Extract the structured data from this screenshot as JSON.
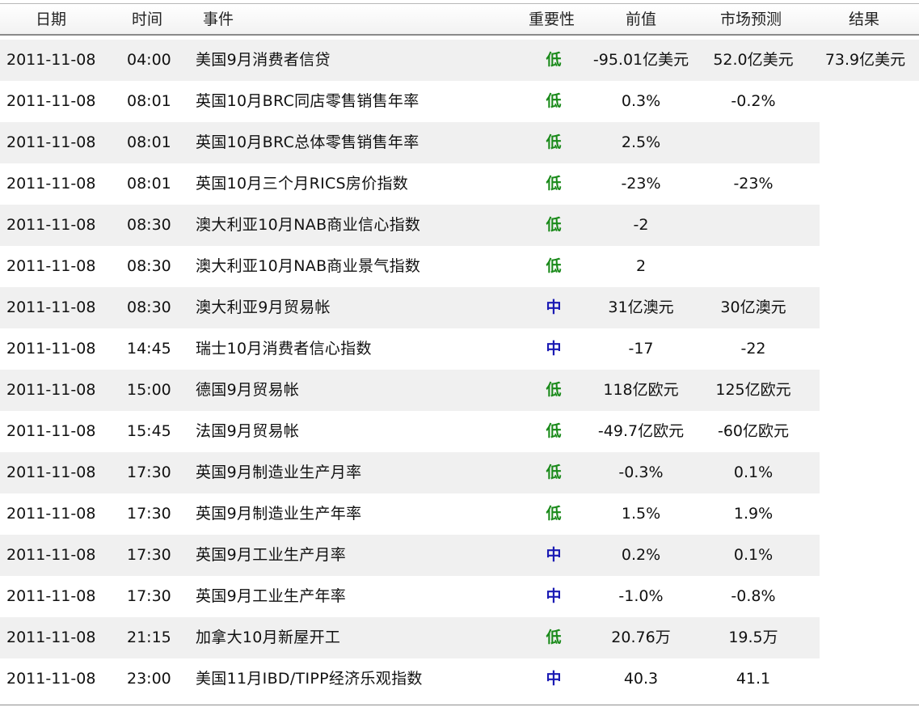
{
  "header": {
    "date": "日期",
    "time": "时间",
    "event": "事件",
    "importance": "重要性",
    "previous": "前值",
    "forecast": "市场预测",
    "result": "结果"
  },
  "colors": {
    "importance_low": "#1a8a1a",
    "importance_medium": "#1a1ab4",
    "row_shade": "#f0f0f0"
  },
  "rows": [
    {
      "date": "2011-11-08",
      "time": "04:00",
      "event": "美国9月消费者信贷",
      "importance": "低",
      "level": "low",
      "previous": "-95.01亿美元",
      "forecast": "52.0亿美元",
      "result": "73.9亿美元"
    },
    {
      "date": "2011-11-08",
      "time": "08:01",
      "event": "英国10月BRC同店零售销售年率",
      "importance": "低",
      "level": "low",
      "previous": "0.3%",
      "forecast": "-0.2%",
      "result": ""
    },
    {
      "date": "2011-11-08",
      "time": "08:01",
      "event": "英国10月BRC总体零售销售年率",
      "importance": "低",
      "level": "low",
      "previous": "2.5%",
      "forecast": "",
      "result": ""
    },
    {
      "date": "2011-11-08",
      "time": "08:01",
      "event": "英国10月三个月RICS房价指数",
      "importance": "低",
      "level": "low",
      "previous": "-23%",
      "forecast": "-23%",
      "result": ""
    },
    {
      "date": "2011-11-08",
      "time": "08:30",
      "event": "澳大利亚10月NAB商业信心指数",
      "importance": "低",
      "level": "low",
      "previous": "-2",
      "forecast": "",
      "result": ""
    },
    {
      "date": "2011-11-08",
      "time": "08:30",
      "event": "澳大利亚10月NAB商业景气指数",
      "importance": "低",
      "level": "low",
      "previous": "2",
      "forecast": "",
      "result": ""
    },
    {
      "date": "2011-11-08",
      "time": "08:30",
      "event": "澳大利亚9月贸易帐",
      "importance": "中",
      "level": "medium",
      "previous": "31亿澳元",
      "forecast": "30亿澳元",
      "result": ""
    },
    {
      "date": "2011-11-08",
      "time": "14:45",
      "event": "瑞士10月消费者信心指数",
      "importance": "中",
      "level": "medium",
      "previous": "-17",
      "forecast": "-22",
      "result": ""
    },
    {
      "date": "2011-11-08",
      "time": "15:00",
      "event": "德国9月贸易帐",
      "importance": "低",
      "level": "low",
      "previous": "118亿欧元",
      "forecast": "125亿欧元",
      "result": ""
    },
    {
      "date": "2011-11-08",
      "time": "15:45",
      "event": "法国9月贸易帐",
      "importance": "低",
      "level": "low",
      "previous": "-49.7亿欧元",
      "forecast": "-60亿欧元",
      "result": ""
    },
    {
      "date": "2011-11-08",
      "time": "17:30",
      "event": "英国9月制造业生产月率",
      "importance": "低",
      "level": "low",
      "previous": "-0.3%",
      "forecast": "0.1%",
      "result": ""
    },
    {
      "date": "2011-11-08",
      "time": "17:30",
      "event": "英国9月制造业生产年率",
      "importance": "低",
      "level": "low",
      "previous": "1.5%",
      "forecast": "1.9%",
      "result": ""
    },
    {
      "date": "2011-11-08",
      "time": "17:30",
      "event": "英国9月工业生产月率",
      "importance": "中",
      "level": "medium",
      "previous": "0.2%",
      "forecast": "0.1%",
      "result": ""
    },
    {
      "date": "2011-11-08",
      "time": "17:30",
      "event": "英国9月工业生产年率",
      "importance": "中",
      "level": "medium",
      "previous": "-1.0%",
      "forecast": "-0.8%",
      "result": ""
    },
    {
      "date": "2011-11-08",
      "time": "21:15",
      "event": "加拿大10月新屋开工",
      "importance": "低",
      "level": "low",
      "previous": "20.76万",
      "forecast": "19.5万",
      "result": ""
    },
    {
      "date": "2011-11-08",
      "time": "23:00",
      "event": "美国11月IBD/TIPP经济乐观指数",
      "importance": "中",
      "level": "medium",
      "previous": "40.3",
      "forecast": "41.1",
      "result": ""
    }
  ]
}
